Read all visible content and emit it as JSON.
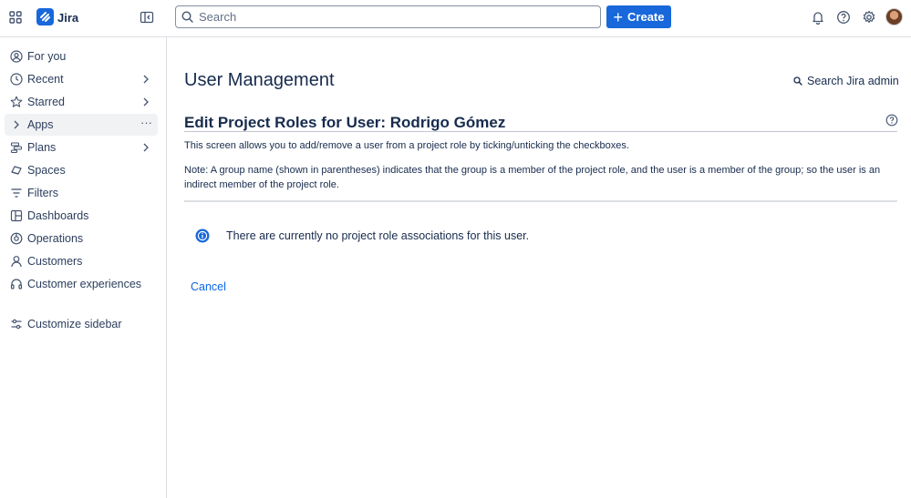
{
  "topbar": {
    "brand": "Jira",
    "search_placeholder": "Search",
    "create_label": "Create",
    "icons": [
      "app-switcher-icon",
      "jira-logo-icon",
      "sidebar-toggle-icon",
      "search-icon",
      "bell-icon",
      "help-icon",
      "gear-icon"
    ]
  },
  "sidebar": {
    "items": [
      {
        "label": "For you",
        "icon": "person-circle-icon"
      },
      {
        "label": "Recent",
        "icon": "clock-icon"
      },
      {
        "label": "Starred",
        "icon": "star-icon"
      },
      {
        "label": "Apps",
        "icon": "chevron-right-icon"
      },
      {
        "label": "Plans",
        "icon": "plans-icon"
      },
      {
        "label": "Spaces",
        "icon": "spaces-icon"
      },
      {
        "label": "Filters",
        "icon": "filter-icon"
      },
      {
        "label": "Dashboards",
        "icon": "dashboard-icon"
      },
      {
        "label": "Operations",
        "icon": "operations-icon"
      },
      {
        "label": "Customers",
        "icon": "person-icon"
      },
      {
        "label": "Customer experiences",
        "icon": "headset-icon"
      }
    ],
    "customize": "Customize sidebar",
    "more": "···"
  },
  "main": {
    "title": "User Management",
    "admin_search": "Search Jira admin",
    "section_title": "Edit Project Roles for User: Rodrigo Gómez",
    "description": "This screen allows you to add/remove a user from a project role by ticking/unticking the checkboxes.",
    "note": "Note: A group name (shown in parentheses) indicates that the group is a member of the project role, and the user is a member of the group; so the user is an indirect member of the project role.",
    "info_message": "There are currently no project role associations for this user.",
    "cancel": "Cancel"
  },
  "colors": {
    "accent": "#1868db",
    "link": "#0c66e4",
    "text": "#172b4d",
    "active_bg": "#f1f2f4"
  }
}
